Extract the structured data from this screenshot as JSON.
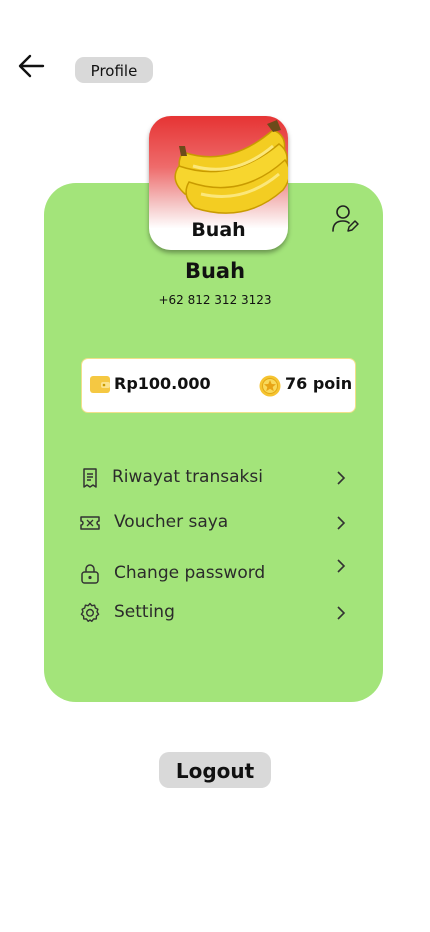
{
  "header": {
    "page_label": "Profile",
    "back_icon": "arrow-left-icon"
  },
  "store": {
    "logo_text": "Buah",
    "name": "Buah",
    "phone": "+62 812 312 3123"
  },
  "wallet": {
    "balance": "Rp100.000",
    "points_value": "76",
    "points_unit": "poin"
  },
  "menu": [
    {
      "label": "Riwayat transaksi",
      "icon": "receipt-icon"
    },
    {
      "label": "Voucher saya",
      "icon": "ticket-icon"
    },
    {
      "label": "Change password",
      "icon": "lock-icon"
    },
    {
      "label": "Setting",
      "icon": "gear-icon"
    }
  ],
  "logout_label": "Logout",
  "colors": {
    "card": "#a3e47a",
    "pill": "#d9d9d9",
    "wallet_icon": "#f5c842",
    "coin": "#f6c431"
  }
}
